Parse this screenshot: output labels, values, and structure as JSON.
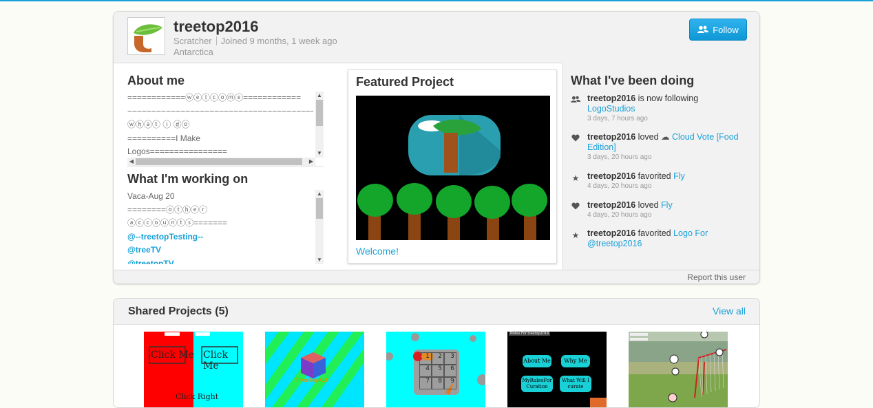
{
  "profile": {
    "username": "treetop2016",
    "role": "Scratcher",
    "joined": "Joined 9 months, 1 week ago",
    "location": "Antarctica",
    "follow_label": "Follow"
  },
  "about": {
    "title": "About me",
    "lines": [
      "============ⓦⓔⓛⓒⓞⓜⓔ============",
      "~~~~~~~~~~~~~~~~~~~~~~~~~~~~~~~~~~~~~~~~~~~~~~~~",
      "ⓦⓗⓐⓣ ⓘ ⓓⓞ",
      "==========I Make",
      "Logos================"
    ]
  },
  "working": {
    "title": "What I'm working on",
    "lines": [
      "Vaca-Aug 20",
      "========ⓞⓣⓗⓔⓡ",
      "ⓐⓒⓒⓞⓤⓝⓣⓢ======="
    ],
    "links": [
      "@--treetopTesting--",
      "@treeTV",
      "@treetopTV"
    ]
  },
  "featured": {
    "title": "Featured Project",
    "project_title": "Welcome!"
  },
  "activity": {
    "title": "What I've been doing",
    "items": [
      {
        "user": "treetop2016",
        "action": "is now following",
        "target": "LogoStudios",
        "time": "3 days, 7 hours ago",
        "icon": "users-icon"
      },
      {
        "user": "treetop2016",
        "action": "loved",
        "target": "Cloud Vote [Food Edition]",
        "time": "3 days, 20 hours ago",
        "icon": "heart-icon"
      },
      {
        "user": "treetop2016",
        "action": "favorited",
        "target": "Fly",
        "time": "4 days, 20 hours ago",
        "icon": "star-icon"
      },
      {
        "user": "treetop2016",
        "action": "loved",
        "target": "Fly",
        "time": "4 days, 20 hours ago",
        "icon": "heart-icon"
      },
      {
        "user": "treetop2016",
        "action": "favorited",
        "target": "Logo For @treetop2016",
        "time": "",
        "icon": "star-icon"
      }
    ]
  },
  "report_label": "Report this user",
  "shared": {
    "title": "Shared Projects (5)",
    "view_all": "View all",
    "thumbs": [
      {
        "texts": [
          "Click Me",
          "Click Me",
          "Click Right"
        ]
      },
      {
        "texts": [
          "TreeTopKit"
        ]
      },
      {
        "texts": [
          "1",
          "2",
          "3",
          "4",
          "5",
          "6",
          "7",
          "8",
          "9"
        ]
      },
      {
        "texts": [
          "About Me",
          "Why Me",
          "MyRulesFor Curation",
          "What Will I curate",
          "Notes For treetop2016"
        ]
      },
      {
        "texts": []
      }
    ]
  },
  "colors": {
    "accent": "#1aa0d8",
    "heading": "#333333"
  }
}
